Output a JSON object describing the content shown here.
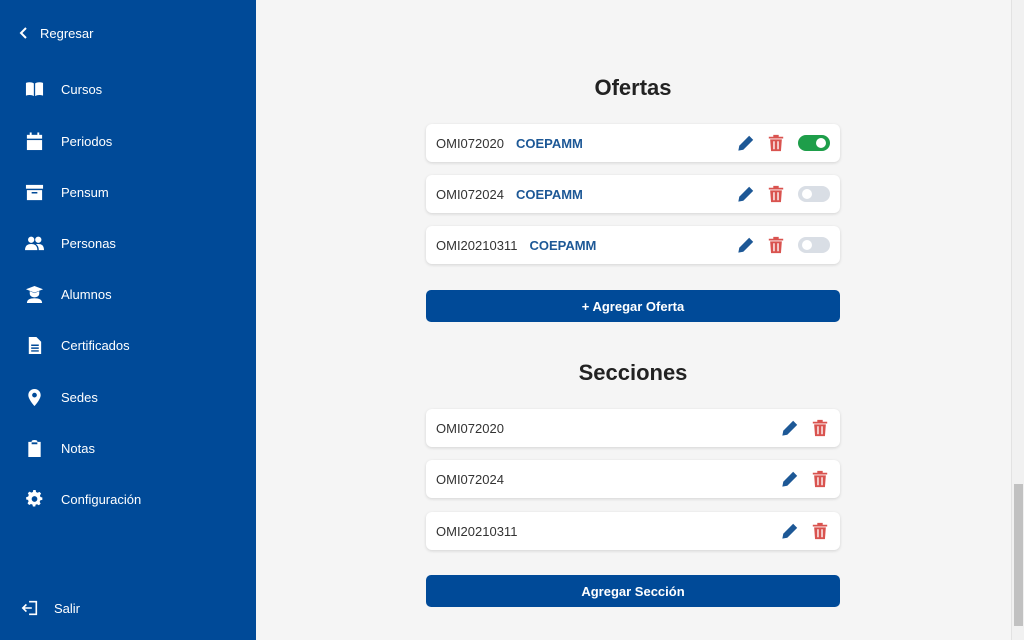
{
  "sidebar": {
    "back_label": "Regresar",
    "items": [
      {
        "label": "Cursos",
        "icon": "book-open-icon"
      },
      {
        "label": "Periodos",
        "icon": "calendar-icon"
      },
      {
        "label": "Pensum",
        "icon": "archive-box-icon"
      },
      {
        "label": "Personas",
        "icon": "users-icon"
      },
      {
        "label": "Alumnos",
        "icon": "graduate-icon"
      },
      {
        "label": "Certificados",
        "icon": "document-icon"
      },
      {
        "label": "Sedes",
        "icon": "map-pin-icon"
      },
      {
        "label": "Notas",
        "icon": "clipboard-icon"
      },
      {
        "label": "Configuración",
        "icon": "gear-icon"
      }
    ],
    "logout_label": "Salir"
  },
  "ofertas": {
    "title": "Ofertas",
    "items": [
      {
        "code": "OMI072020",
        "org": "COEPAMM",
        "active": true
      },
      {
        "code": "OMI072024",
        "org": "COEPAMM",
        "active": false
      },
      {
        "code": "OMI20210311",
        "org": "COEPAMM",
        "active": false
      }
    ],
    "add_label": "+ Agregar Oferta"
  },
  "secciones": {
    "title": "Secciones",
    "items": [
      {
        "code": "OMI072020"
      },
      {
        "code": "OMI072024"
      },
      {
        "code": "OMI20210311"
      }
    ],
    "add_label": "Agregar Sección"
  },
  "colors": {
    "primary": "#004a98",
    "accent_text": "#1d5896",
    "danger": "#d9534f",
    "success": "#1e9e4a"
  }
}
